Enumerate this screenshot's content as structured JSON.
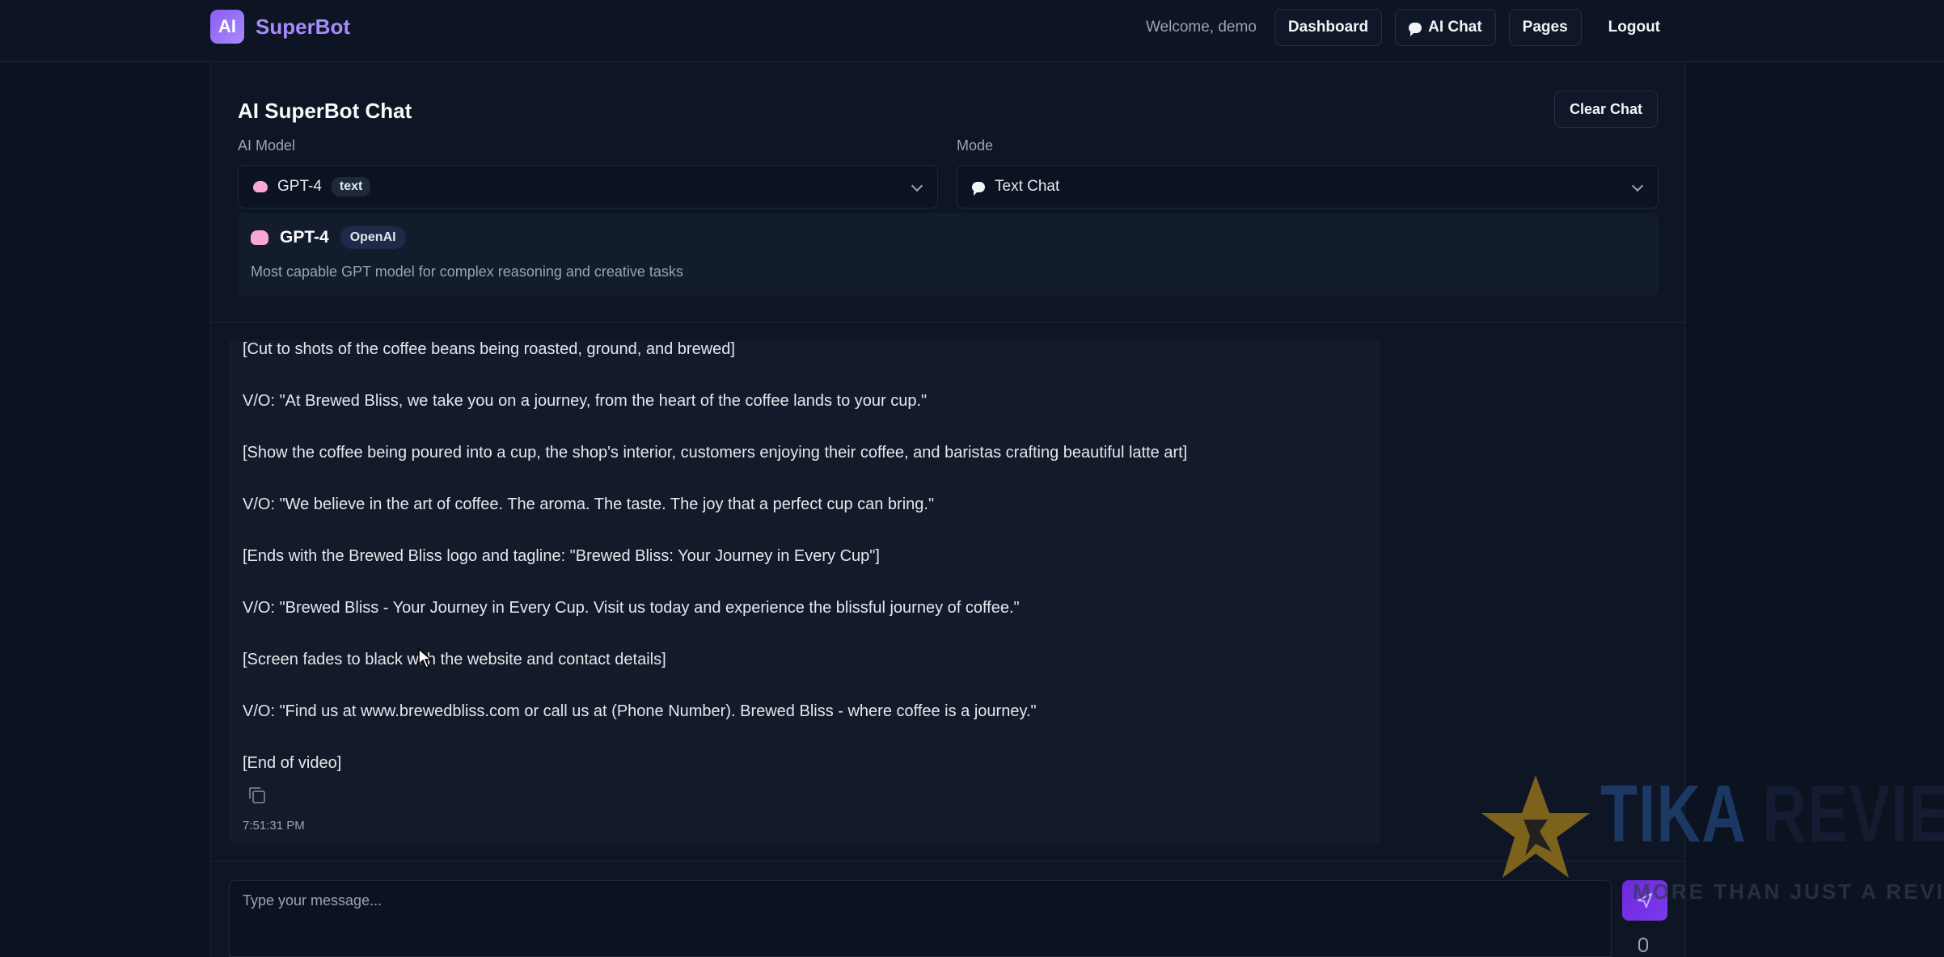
{
  "colors": {
    "background": "#0b1220",
    "panel": "#0e1626",
    "accent": "#8b5cf6",
    "text": "#e5e7eb",
    "muted": "#9ca3af"
  },
  "brand": {
    "logo_text": "AI",
    "name": "SuperBot"
  },
  "nav": {
    "welcome": "Welcome, demo",
    "dashboard": "Dashboard",
    "ai_chat": "AI Chat",
    "pages": "Pages",
    "logout": "Logout"
  },
  "chat": {
    "title": "AI SuperBot Chat",
    "clear_label": "Clear Chat",
    "model_label": "AI Model",
    "model_selected": "GPT-4",
    "model_tag": "text",
    "mode_label": "Mode",
    "mode_selected": "Text Chat"
  },
  "model_card": {
    "name": "GPT-4",
    "provider": "OpenAI",
    "description": "Most capable GPT model for complex reasoning and creative tasks"
  },
  "message": {
    "lines": [
      "[Cut to shots of the coffee beans being roasted, ground, and brewed]",
      "V/O: \"At Brewed Bliss, we take you on a journey, from the heart of the coffee lands to your cup.\"",
      "[Show the coffee being poured into a cup, the shop's interior, customers enjoying their coffee, and baristas crafting beautiful latte art]",
      "V/O: \"We believe in the art of coffee. The aroma. The taste. The joy that a perfect cup can bring.\"",
      "[Ends with the Brewed Bliss logo and tagline: \"Brewed Bliss: Your Journey in Every Cup\"]",
      "V/O: \"Brewed Bliss - Your Journey in Every Cup. Visit us today and experience the blissful journey of coffee.\"",
      "[Screen fades to black with the website and contact details]",
      "V/O: \"Find us at www.brewedbliss.com or call us at (Phone Number). Brewed Bliss - where coffee is a journey.\"",
      "[End of video]"
    ],
    "timestamp": "7:51:31 PM"
  },
  "input": {
    "placeholder": "Type your message..."
  },
  "watermark": {
    "title_a": "TIKA",
    "title_b": "REVIEW",
    "subtitle": "MORE THAN JUST A REVIEW"
  }
}
